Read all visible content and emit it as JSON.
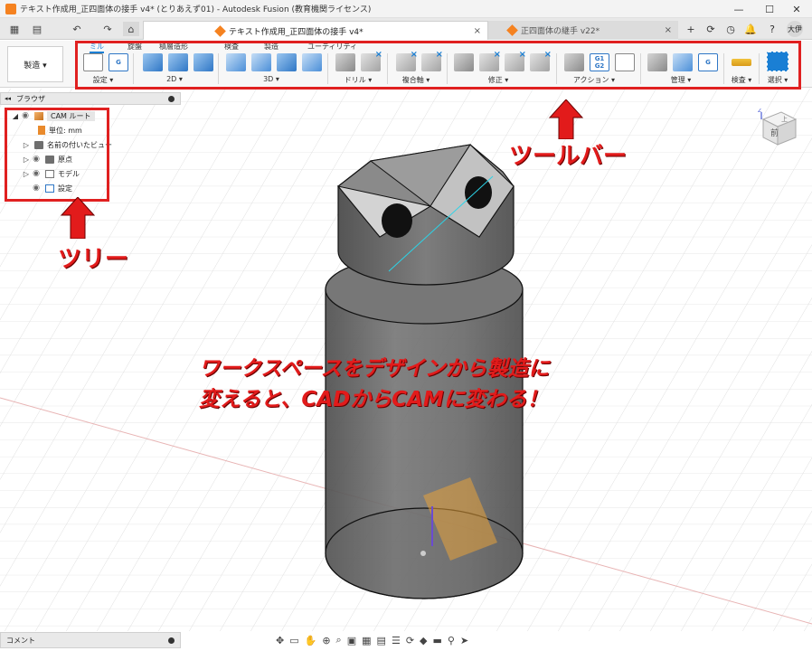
{
  "window": {
    "title": "テキスト作成用_正四面体の接手 v4* (とりあえず01) - Autodesk Fusion (教育機関ライセンス)",
    "minimize": "—",
    "maximize": "☐",
    "close": "✕"
  },
  "quick_access": {
    "grid": "▦",
    "file": "▤",
    "undo": "↶",
    "redo": "↷",
    "home": "⌂"
  },
  "doc_tabs": [
    {
      "label": "テキスト作成用_正四面体の接手 v4*",
      "close": "×"
    },
    {
      "label": "正四面体の継手 v22*",
      "close": "×"
    }
  ],
  "tabbar_right": {
    "new_tab": "+",
    "online": "⟳",
    "history": "◷",
    "notifications": "🔔",
    "help": "?",
    "avatar": "大伊"
  },
  "toolbar": {
    "workspace": "製造 ▾",
    "tabs": [
      "ミル",
      "旋盤",
      "積層造形",
      "検査",
      "製造",
      "ユーティリティ"
    ],
    "groups": [
      "設定 ▾",
      "2D ▾",
      "3D ▾",
      "ドリル ▾",
      "複合軸 ▾",
      "修正 ▾",
      "アクション ▾",
      "管理 ▾",
      "検査 ▾",
      "選択 ▾"
    ],
    "g1g2_top": "G1",
    "g1g2_bottom": "G2",
    "g_label": "G"
  },
  "browser": {
    "title": "ブラウザ",
    "collapse": "◂◂",
    "items": [
      {
        "label": "CAM ルート"
      },
      {
        "label": "単位: mm"
      },
      {
        "label": "名前の付いたビュー"
      },
      {
        "label": "原点"
      },
      {
        "label": "モデル"
      },
      {
        "label": "設定"
      }
    ]
  },
  "annotations": {
    "toolbar_label": "ツールバー",
    "tree_label": "ツリー",
    "message_line1": "ワークスペースをデザインから製造に",
    "message_line2": "変えると、CADからCAMに変わる！"
  },
  "viewcube": {
    "face_front": "前",
    "face_top": "上",
    "axis_z": "Z",
    "axis_x": "X"
  },
  "comments": {
    "label": "コメント"
  },
  "colors": {
    "annotation_red": "#e21b1b",
    "accent_blue": "#1a7fd4",
    "brand_orange": "#f58220",
    "model_gray": "#6b6b6b"
  }
}
